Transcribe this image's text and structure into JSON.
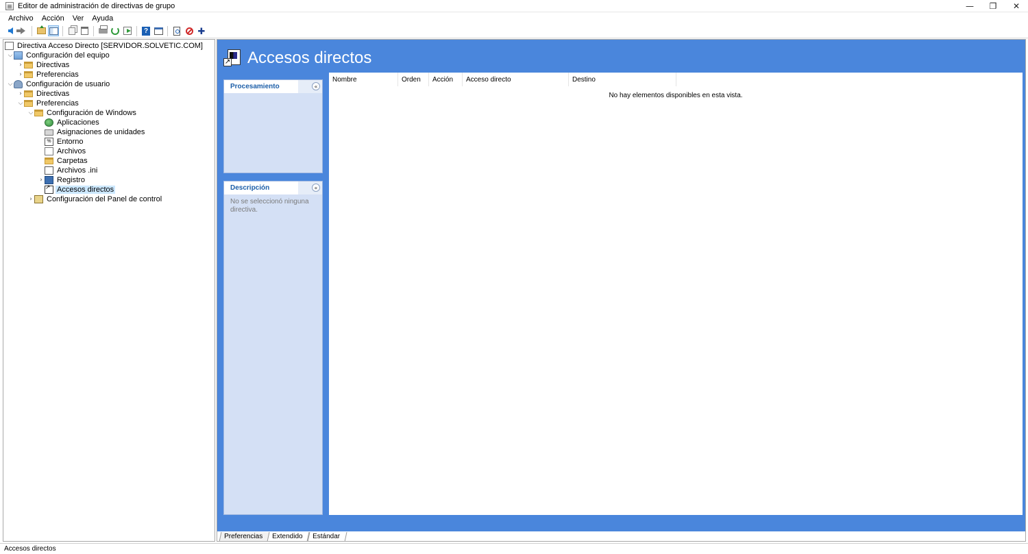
{
  "window": {
    "title": "Editor de administración de directivas de grupo",
    "minimize": "—",
    "restore": "❐",
    "close": "✕"
  },
  "menu": [
    "Archivo",
    "Acción",
    "Ver",
    "Ayuda"
  ],
  "toolbar": {
    "icons": [
      "back-icon",
      "forward-icon",
      "folder-up-icon",
      "show-hide-tree-icon",
      "copy-icon",
      "paste-icon",
      "print-icon",
      "refresh-icon",
      "export-list-icon",
      "help-icon",
      "console-window-icon",
      "properties-icon",
      "disable-icon",
      "add-icon"
    ]
  },
  "tree": {
    "root": "Directiva Acceso Directo [SERVIDOR.SOLVETIC.COM]",
    "computer_config": "Configuración del equipo",
    "computer_policies": "Directivas",
    "computer_preferences": "Preferencias",
    "user_config": "Configuración de usuario",
    "user_policies": "Directivas",
    "user_preferences": "Preferencias",
    "windows_settings": "Configuración de Windows",
    "applications": "Aplicaciones",
    "drive_maps": "Asignaciones de unidades",
    "environment": "Entorno",
    "files": "Archivos",
    "folders": "Carpetas",
    "ini_files": "Archivos .ini",
    "registry": "Registro",
    "shortcuts": "Accesos directos",
    "control_panel": "Configuración del Panel de control",
    "env_icon_text": "%"
  },
  "header": {
    "title": "Accesos directos"
  },
  "panels": {
    "processing": {
      "title": "Procesamiento",
      "collapse": "«"
    },
    "description": {
      "title": "Descripción",
      "collapse": "«",
      "text": "No se seleccionó ninguna directiva."
    }
  },
  "list": {
    "columns": [
      "Nombre",
      "Orden",
      "Acción",
      "Acceso directo",
      "Destino"
    ],
    "empty_message": "No hay elementos disponibles en esta vista."
  },
  "tabs": [
    "Preferencias",
    "Extendido",
    "Estándar"
  ],
  "status": {
    "text": "Accesos directos"
  }
}
